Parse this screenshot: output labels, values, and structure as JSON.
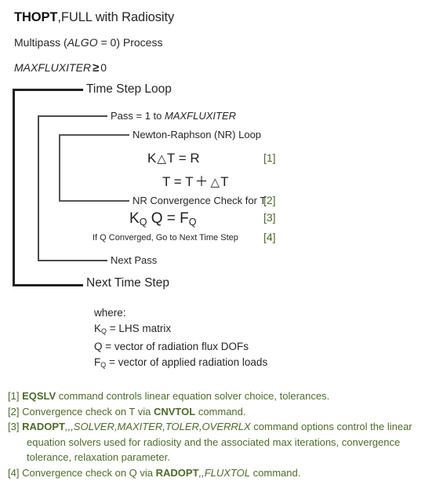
{
  "header": {
    "title_bold": "THOPT",
    "title_rest": ",FULL with Radiosity",
    "subtitle_pre": "Multipass (",
    "subtitle_italic": "ALGO",
    "subtitle_post": " = 0) Process",
    "condition_italic": "MAXFLUXITER",
    "condition_symbol": "≥",
    "condition_value": "0"
  },
  "diagram": {
    "time_step_loop": "Time Step Loop",
    "pass_pre": "Pass = 1 to ",
    "pass_italic": "MAXFLUXITER",
    "nr_loop": "Newton-Raphson (NR) Loop",
    "nr_convergence_check": "NR Convergence Check for T",
    "q_converged_note": "If Q Converged, Go to Next Time Step",
    "next_pass": "Next Pass",
    "next_time_step": "Next Time Step",
    "equations": {
      "eq1_a": "K",
      "eq1_tri": "△",
      "eq1_b": "T = R",
      "eq2_a": "T = T",
      "eq2_plus": "＋",
      "eq2_tri": "△",
      "eq2_b": "T",
      "eq3_k": "K",
      "eq3_ksub": "Q",
      "eq3_mid": " Q = F",
      "eq3_fsub": "Q"
    },
    "refs": {
      "r1": "[1]",
      "r2": "[2]",
      "r3": "[3]",
      "r4": "[4]"
    }
  },
  "legend": {
    "heading": "where:",
    "line_kq_sym": "K",
    "line_kq_sub": "Q",
    "line_kq_text": " = LHS matrix",
    "line_q": "Q = vector of radiation flux DOFs",
    "line_fq_sym": "F",
    "line_fq_sub": "Q",
    "line_fq_text": " = vector of applied radiation loads"
  },
  "footnotes": {
    "f1_tag": "[1] ",
    "f1_cmd": "EQSLV",
    "f1_text": " command controls linear equation solver choice, tolerances.",
    "f2_tag": "[2] ",
    "f2_pre": "Convergence check on T via ",
    "f2_cmd": "CNVTOL",
    "f2_post": " command.",
    "f3_tag": "[3] ",
    "f3_cmd": "RADOPT",
    "f3_args": ",,,SOLVER,MAXITER,TOLER,OVERRLX",
    "f3_text": " command options control the linear equation solvers used for radiosity and the associated max iterations, convergence tolerance, relaxation parameter.",
    "f4_tag": "[4] ",
    "f4_pre": "Convergence check on Q via ",
    "f4_cmd": "RADOPT",
    "f4_args": ",,FLUXTOL",
    "f4_post": " command."
  },
  "colors": {
    "reference_green": "#4d6b2a",
    "text_dark": "#262626",
    "bracket_dark": "#222222"
  }
}
